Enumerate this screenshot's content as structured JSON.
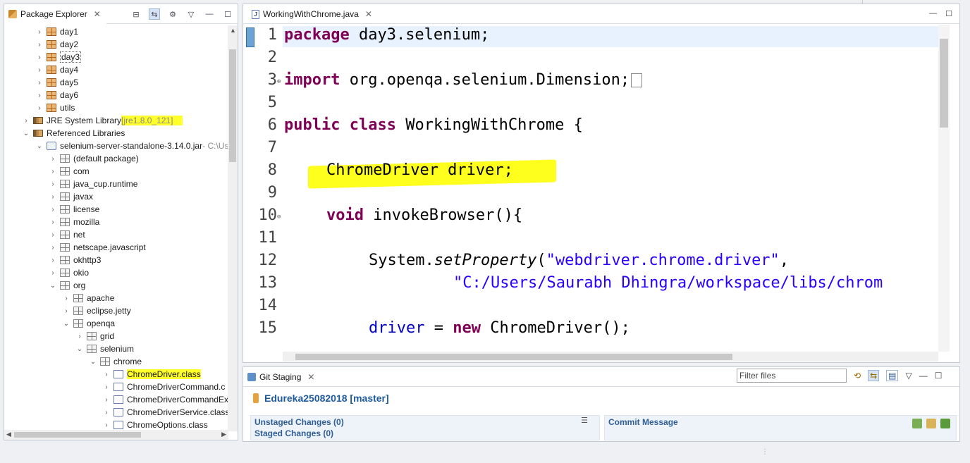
{
  "package_explorer": {
    "title": "Package Explorer",
    "tree": [
      {
        "label": "day1",
        "icon": "package-icon",
        "chevron": "›"
      },
      {
        "label": "day2",
        "icon": "package-icon",
        "chevron": "›"
      },
      {
        "label": "day3",
        "icon": "package-icon",
        "chevron": "›"
      },
      {
        "label": "day4",
        "icon": "package-icon",
        "chevron": "›"
      },
      {
        "label": "day5",
        "icon": "package-icon",
        "chevron": "›"
      },
      {
        "label": "day6",
        "icon": "package-icon",
        "chevron": "›"
      },
      {
        "label": "utils",
        "icon": "package-icon",
        "chevron": "›"
      },
      {
        "label": "JRE System Library",
        "suffix": "[jre1.8.0_121]",
        "icon": "library-icon",
        "chevron": "›"
      },
      {
        "label": "Referenced Libraries",
        "icon": "library-icon",
        "chevron": "⌄"
      },
      {
        "label": "selenium-server-standalone-3.14.0.jar",
        "suffix": " - C:\\Us",
        "icon": "jar-icon",
        "chevron": "⌄"
      },
      {
        "label": "(default package)",
        "icon": "package-icon",
        "chevron": "›"
      },
      {
        "label": "com",
        "icon": "package-icon",
        "chevron": "›"
      },
      {
        "label": "java_cup.runtime",
        "icon": "package-icon",
        "chevron": "›"
      },
      {
        "label": "javax",
        "icon": "package-icon",
        "chevron": "›"
      },
      {
        "label": "license",
        "icon": "package-icon",
        "chevron": "›"
      },
      {
        "label": "mozilla",
        "icon": "package-icon",
        "chevron": "›"
      },
      {
        "label": "net",
        "icon": "package-icon",
        "chevron": "›"
      },
      {
        "label": "netscape.javascript",
        "icon": "package-icon",
        "chevron": "›"
      },
      {
        "label": "okhttp3",
        "icon": "package-icon",
        "chevron": "›"
      },
      {
        "label": "okio",
        "icon": "package-icon",
        "chevron": "›"
      },
      {
        "label": "org",
        "icon": "package-icon",
        "chevron": "⌄"
      },
      {
        "label": "apache",
        "icon": "package-icon",
        "chevron": "›"
      },
      {
        "label": "eclipse.jetty",
        "icon": "package-icon",
        "chevron": "›"
      },
      {
        "label": "openqa",
        "icon": "package-icon",
        "chevron": "⌄"
      },
      {
        "label": "grid",
        "icon": "package-icon",
        "chevron": "›"
      },
      {
        "label": "selenium",
        "icon": "package-icon",
        "chevron": "⌄"
      },
      {
        "label": "chrome",
        "icon": "package-icon",
        "chevron": "⌄"
      },
      {
        "label": "ChromeDriver.class",
        "icon": "class-file-icon",
        "chevron": "›"
      },
      {
        "label": "ChromeDriverCommand.c",
        "icon": "class-file-icon",
        "chevron": "›"
      },
      {
        "label": "ChromeDriverCommandEx",
        "icon": "class-file-icon",
        "chevron": "›"
      },
      {
        "label": "ChromeDriverService.class",
        "icon": "class-file-icon",
        "chevron": "›"
      },
      {
        "label": "ChromeOptions.class",
        "icon": "class-file-icon",
        "chevron": "›"
      }
    ]
  },
  "editor": {
    "tab_title": "WorkingWithChrome.java",
    "lines": [
      {
        "n": "1"
      },
      {
        "n": "2"
      },
      {
        "n": "3"
      },
      {
        "n": "5"
      },
      {
        "n": "6"
      },
      {
        "n": "7"
      },
      {
        "n": "8"
      },
      {
        "n": "9"
      },
      {
        "n": "10"
      },
      {
        "n": "11"
      },
      {
        "n": "12"
      },
      {
        "n": "13"
      },
      {
        "n": "14"
      },
      {
        "n": "15"
      }
    ],
    "code": {
      "l1_kw": "package",
      "l1_rest": " day3.selenium;",
      "l3_kw": "import",
      "l3_rest": " org.openqa.selenium.Dimension;",
      "l6_kw1": "public",
      "l6_kw2": "class",
      "l6_rest": " WorkingWithChrome {",
      "l8_text": "ChromeDriver driver;",
      "l10_kw": "void",
      "l10_rest": " invokeBrowser(){",
      "l12_a": "System.",
      "l12_method": "setProperty",
      "l12_b": "(",
      "l12_str": "\"webdriver.chrome.driver\"",
      "l12_c": ",",
      "l13_str": "\"C:/Users/Saurabh Dhingra/workspace/libs/chrom",
      "l15_field": "driver",
      "l15_a": " = ",
      "l15_kw": "new",
      "l15_b": " ChromeDriver();"
    }
  },
  "git_staging": {
    "title": "Git Staging",
    "filter_placeholder": "Filter files",
    "repo": "Edureka25082018 [master]",
    "unstaged": "Unstaged Changes (0)",
    "staged": "Staged Changes (0)",
    "commit_message": "Commit Message"
  },
  "colors": {
    "highlight": "#ffff2a",
    "keyword": "#7f0055",
    "string": "#2a00ff",
    "field": "#0000c0",
    "section_title": "#2f5e97"
  }
}
